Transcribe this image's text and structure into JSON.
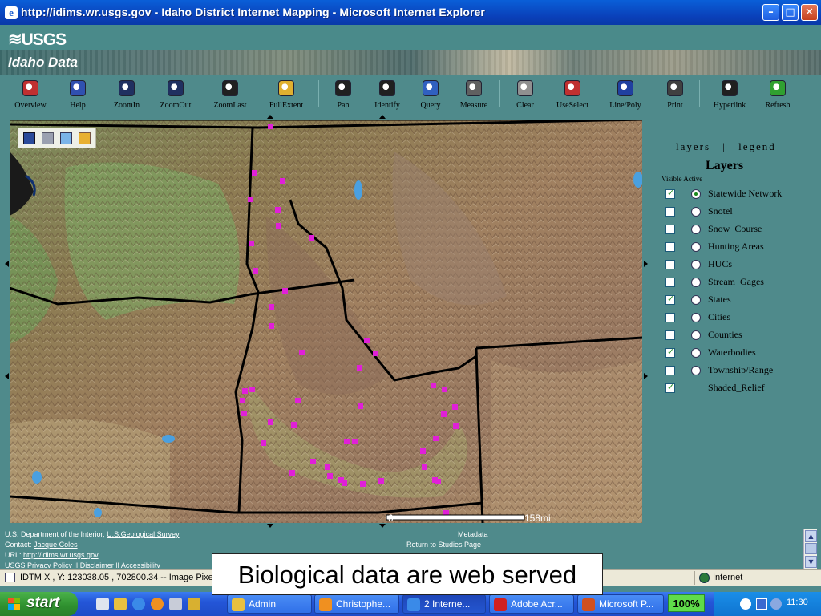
{
  "window": {
    "title": "http://idims.wr.usgs.gov - Idaho District Internet Mapping - Microsoft Internet Explorer",
    "minimize": "–",
    "maximize": "□",
    "close": "✕"
  },
  "header": {
    "logo": "≋USGS",
    "site_name": "Idaho Data"
  },
  "toolbar": {
    "tools": [
      {
        "label": "Overview",
        "icon": "overview-icon"
      },
      {
        "label": "Help",
        "icon": "help-book-icon"
      },
      {
        "label": "ZoomIn",
        "icon": "zoom-in-icon"
      },
      {
        "label": "ZoomOut",
        "icon": "zoom-out-icon"
      },
      {
        "label": "ZoomLast",
        "icon": "zoom-last-icon"
      },
      {
        "label": "FullExtent",
        "icon": "full-extent-icon"
      },
      {
        "label": "Pan",
        "icon": "pan-hand-icon"
      },
      {
        "label": "Identify",
        "icon": "identify-icon"
      },
      {
        "label": "Query",
        "icon": "query-icon"
      },
      {
        "label": "Measure",
        "icon": "measure-icon"
      },
      {
        "label": "Clear",
        "icon": "clear-eraser-icon"
      },
      {
        "label": "UseSelect",
        "icon": "use-select-icon"
      },
      {
        "label": "Line/Poly",
        "icon": "line-poly-icon"
      },
      {
        "label": "Print",
        "icon": "print-icon"
      },
      {
        "label": "Hyperlink",
        "icon": "hyperlink-bolt-icon"
      },
      {
        "label": "Refresh",
        "icon": "refresh-icon"
      }
    ]
  },
  "map": {
    "scale_start": "0",
    "scale_end": "158mi",
    "marker_color": "#e020d8",
    "mini_toolbar_icons": [
      "save-icon",
      "print-icon",
      "email-icon",
      "folder-icon"
    ]
  },
  "panel": {
    "tab_layers": "layers",
    "tab_separator": "|",
    "tab_legend": "legend",
    "title": "Layers",
    "column_header": "Visible Active",
    "layers": [
      {
        "name": "Statewide Network",
        "visible": true,
        "active": true
      },
      {
        "name": "Snotel",
        "visible": false,
        "active": false
      },
      {
        "name": "Snow_Course",
        "visible": false,
        "active": false
      },
      {
        "name": "Hunting Areas",
        "visible": false,
        "active": false
      },
      {
        "name": "HUCs",
        "visible": false,
        "active": false
      },
      {
        "name": "Stream_Gages",
        "visible": false,
        "active": false
      },
      {
        "name": "States",
        "visible": true,
        "active": false
      },
      {
        "name": "Cities",
        "visible": false,
        "active": false
      },
      {
        "name": "Counties",
        "visible": false,
        "active": false
      },
      {
        "name": "Waterbodies",
        "visible": true,
        "active": false
      },
      {
        "name": "Township/Range",
        "visible": false,
        "active": false
      },
      {
        "name": "Shaded_Relief",
        "visible": true,
        "active": null
      }
    ]
  },
  "footer": {
    "dept": "U.S. Department of the Interior,",
    "survey_link": "U.S.Geological Survey",
    "contact_label": "Contact:",
    "contact_name": "Jacque Coles",
    "url_label": "URL:",
    "url": "http://idims.wr.usgs.gov",
    "privacy": "USGS Privacy Policy || Disclaimer || Accessibility",
    "metadata": "Metadata",
    "return": "Return to Studies Page"
  },
  "statusbar": {
    "coords": "IDTM X , Y: 123038.05 , 702800.34 -- Image Pixel",
    "zone": "Internet"
  },
  "caption": "Biological data are web served",
  "taskbar": {
    "start": "start",
    "tasks": [
      {
        "label": "Admin",
        "icon_color": "#e8c040"
      },
      {
        "label": "Christophe...",
        "icon_color": "#f09020"
      },
      {
        "label": "2 Interne...",
        "icon_color": "#3a8ae8"
      },
      {
        "label": "Adobe Acr...",
        "icon_color": "#d02020"
      },
      {
        "label": "Microsoft P...",
        "icon_color": "#d05020"
      }
    ],
    "zoom": "100%",
    "clock": "11:30"
  }
}
